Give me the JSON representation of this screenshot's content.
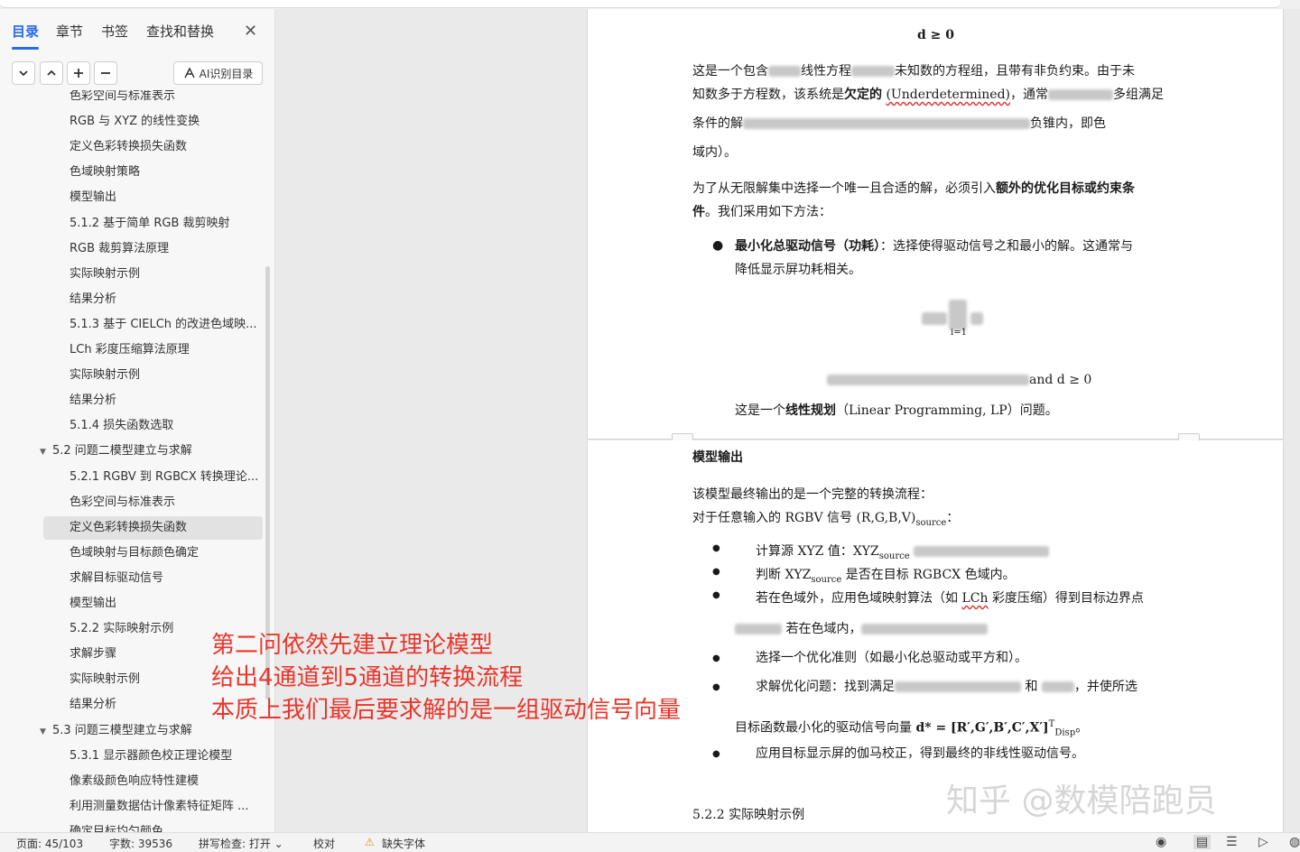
{
  "sidebar": {
    "tabs": [
      "目录",
      "章节",
      "书签",
      "查找和替换"
    ],
    "toolbar": {
      "ai_button": "AI识别目录"
    },
    "toc": [
      {
        "label": "色彩空间与标准表示",
        "level": 3
      },
      {
        "label": "RGB 与 XYZ 的线性变换",
        "level": 3
      },
      {
        "label": "定义色彩转换损失函数",
        "level": 3
      },
      {
        "label": "色域映射策略",
        "level": 3
      },
      {
        "label": "模型输出",
        "level": 3
      },
      {
        "label": "5.1.2 基于简单 RGB 裁剪映射",
        "level": 3
      },
      {
        "label": "RGB 裁剪算法原理",
        "level": 3
      },
      {
        "label": "实际映射示例",
        "level": 3
      },
      {
        "label": "结果分析",
        "level": 3
      },
      {
        "label": "5.1.3 基于 CIELCh 的改进色域映...",
        "level": 3
      },
      {
        "label": "LCh 彩度压缩算法原理",
        "level": 3
      },
      {
        "label": "实际映射示例",
        "level": 3
      },
      {
        "label": "结果分析",
        "level": 3
      },
      {
        "label": "5.1.4 损失函数选取",
        "level": 3
      },
      {
        "label": "5.2 问题二模型建立与求解",
        "level": 2
      },
      {
        "label": "5.2.1 RGBV 到 RGBCX 转换理论...",
        "level": 3
      },
      {
        "label": "色彩空间与标准表示",
        "level": 3
      },
      {
        "label": "定义色彩转换损失函数",
        "level": 3,
        "selected": true
      },
      {
        "label": "色域映射与目标颜色确定",
        "level": 3
      },
      {
        "label": "求解目标驱动信号",
        "level": 3
      },
      {
        "label": "模型输出",
        "level": 3
      },
      {
        "label": "5.2.2 实际映射示例",
        "level": 3
      },
      {
        "label": "求解步骤",
        "level": 3
      },
      {
        "label": "实际映射示例",
        "level": 3
      },
      {
        "label": "结果分析",
        "level": 3
      },
      {
        "label": "5.3 问题三模型建立与求解",
        "level": 2
      },
      {
        "label": "5.3.1 显示器颜色校正理论模型",
        "level": 3
      },
      {
        "label": "像素级颜色响应特性建模",
        "level": 3
      },
      {
        "label": "利用测量数据估计像素特征矩阵 ...",
        "level": 3
      },
      {
        "label": "确定目标均匀颜色",
        "level": 3
      }
    ]
  },
  "doc": {
    "p1": {
      "eq_top": "d ≥ 0",
      "para1_l1a": "这是一个包含",
      "para1_l1b": "线性方程",
      "para1_l1c": "未知数的方程组，且带有非负约束。由于未",
      "para1_l2a": "知数多于方程数，该系统是",
      "para1_l2b": "欠定的",
      "para1_l2c": "(Underdetermined)",
      "para1_l2d": "，通常",
      "para1_l2e": "多组满足",
      "para1_l3a": "条件的解",
      "para1_l3b": "负锥内，即色",
      "para1_l4": "域内）。",
      "para2_l1a": "为了从无限解集中选择一个唯一且合适的解，必须引入",
      "para2_l1b": "额外的优化目标或约束条",
      "para2_l2a": "件",
      "para2_l2b": "。我们采用如下方法：",
      "bullet1_a": "最小化总驱动信号（功耗）",
      "bullet1_b": "：选择使得驱动信号之和最小的解。这通常与",
      "bullet1_c": "降低显示屏功耗相关。",
      "eq_sum_index": "i=1",
      "eq_subject_tail": "and d ≥ 0",
      "lp_a": "这是一个",
      "lp_b": "线性规划",
      "lp_c": "（Linear Programming, LP）问题。"
    },
    "p2": {
      "heading": "模型输出",
      "intro1": "该模型最终输出的是一个完整的转换流程：",
      "intro2": "对于任意输入的 RGBV 信号 (R,G,B,V)",
      "intro2_sub": "source",
      "intro2_end": "：",
      "b1": "计算源 XYZ 值：XYZ",
      "b1_sub": "source",
      "b2a": "判断 XYZ",
      "b2_sub": "source",
      "b2b": " 是否在目标 RGBCX 色域内。",
      "b3a": "若在色域外，应用色域映射算法（如",
      "b3b": "LCh",
      "b3c": "彩度压缩）得到目标边界点",
      "b3d": "若在色域内，",
      "b4": "选择一个优化准则（如最小化总驱动或平方和）。",
      "b5a": "求解优化问题：找到满足",
      "b5b": "和",
      "b5c": "，并使所选",
      "b5d": "目标函数最小化的驱动信号向量",
      "b5e": "d* = [R′,G′,B′,C′,X′]",
      "b5_sup": "T",
      "b5_sub": "Disp",
      "b5_end": "。",
      "b6": "应用目标显示屏的伽马校正，得到最终的非线性驱动信号。",
      "next_heading": "5.2.2 实际映射示例"
    }
  },
  "annotation": {
    "line1": "第二问依然先建立理论模型",
    "line2": "给出4通道到5通道的转换流程",
    "line3": "本质上我们最后要求解的是一组驱动信号向量"
  },
  "watermark": "知乎 @数模陪跑员",
  "status": {
    "page": "页面: 45/103",
    "words": "字数: 39536",
    "spell": "拼写检查: 打开",
    "proof": "校对",
    "font_warn": "缺失字体"
  },
  "colors": {
    "accent": "#2a6ae9",
    "annotation": "#e8362c"
  }
}
